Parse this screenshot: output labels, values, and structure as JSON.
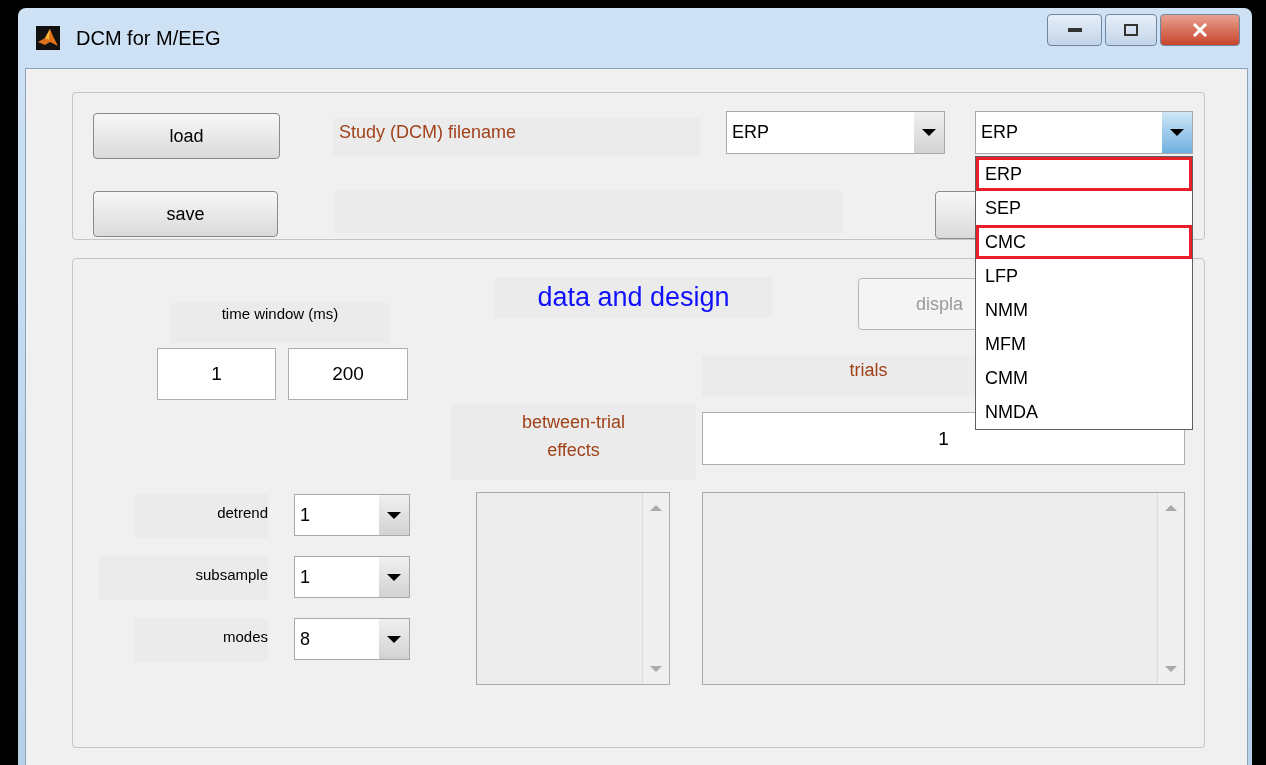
{
  "window": {
    "title": "DCM for M/EEG"
  },
  "file_panel": {
    "load_button": "load",
    "filename_label": "Study (DCM) filename",
    "data_type": {
      "value": "ERP"
    },
    "model": {
      "value": "ERP",
      "expanded": true,
      "options": [
        {
          "label": "ERP",
          "highlighted": true
        },
        {
          "label": "SEP",
          "highlighted": false
        },
        {
          "label": "CMC",
          "highlighted": true
        },
        {
          "label": "LFP",
          "highlighted": false
        },
        {
          "label": "NMM",
          "highlighted": false
        },
        {
          "label": "MFM",
          "highlighted": false
        },
        {
          "label": "CMM",
          "highlighted": false
        },
        {
          "label": "NMDA",
          "highlighted": false
        }
      ]
    },
    "save_button": "save"
  },
  "design_panel": {
    "title": "data and design",
    "display_button": {
      "label": "displa",
      "disabled": true
    },
    "time_window": {
      "label": "time window (ms)",
      "start": "1",
      "end": "200"
    },
    "trials": {
      "label": "trials",
      "value": "1"
    },
    "between_trial": {
      "label": "between-trial effects"
    },
    "settings": [
      {
        "label": "detrend",
        "value": "1"
      },
      {
        "label": "subsample",
        "value": "1"
      },
      {
        "label": "modes",
        "value": "8"
      }
    ]
  }
}
